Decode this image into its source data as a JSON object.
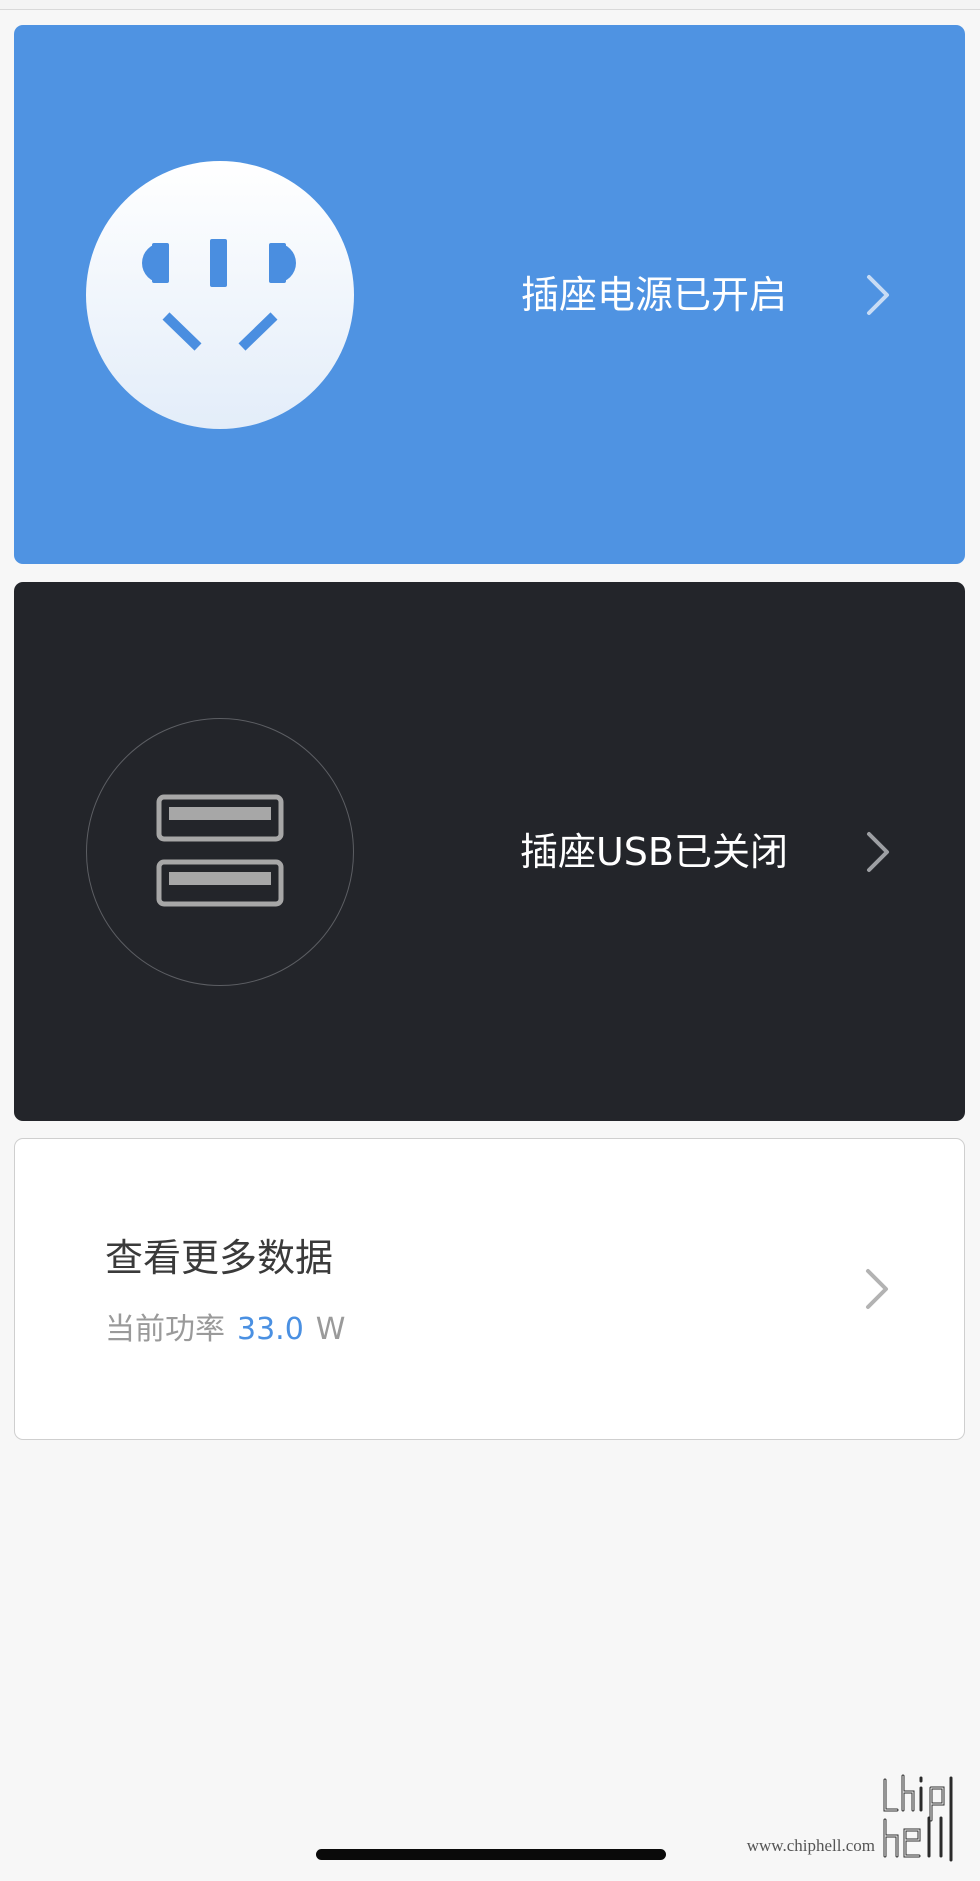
{
  "power_card": {
    "label": "插座电源已开启",
    "icon": "power-socket-icon",
    "chevron": "chevron-right-icon",
    "accent": "#4f93e2"
  },
  "usb_card": {
    "label": "插座USB已关闭",
    "icon": "usb-port-icon",
    "chevron": "chevron-right-icon",
    "background": "#23252a"
  },
  "data_card": {
    "title": "查看更多数据",
    "power_label": "当前功率",
    "power_value": "33.0",
    "power_unit": "W",
    "chevron": "chevron-right-icon",
    "value_color": "#4a90e2"
  },
  "watermark": {
    "url": "www.chiphell.com",
    "logo_text": "chip hell"
  }
}
